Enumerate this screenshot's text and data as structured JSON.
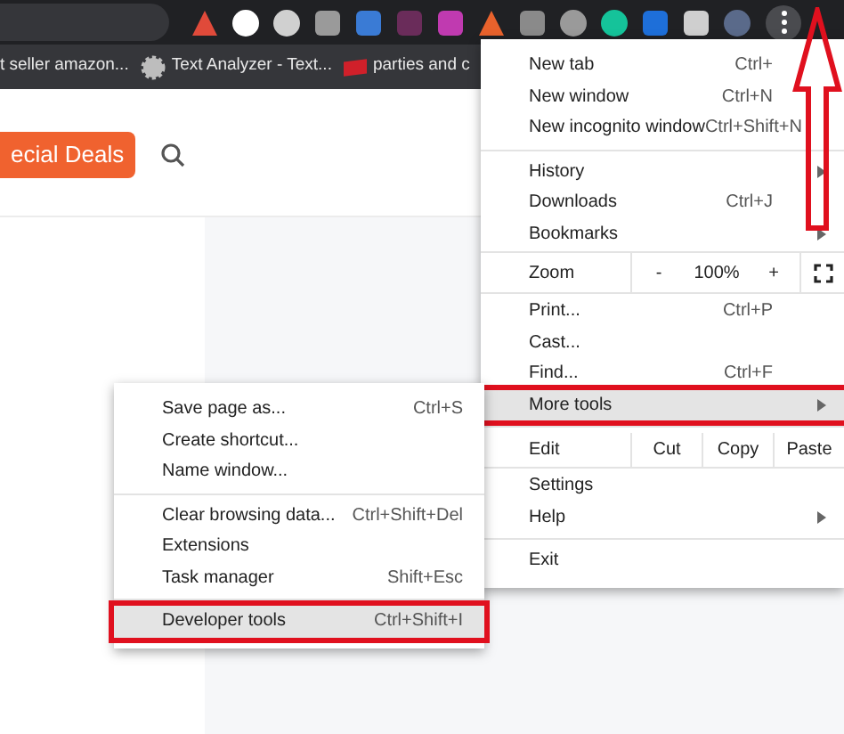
{
  "bookmarks": [
    {
      "label": "t seller amazon..."
    },
    {
      "label": "Text Analyzer - Text..."
    },
    {
      "label": "parties and c"
    }
  ],
  "page": {
    "deals_button": "ecial Deals"
  },
  "menu": {
    "items": [
      {
        "kind": "item",
        "label": "New tab",
        "shortcut": "Ctrl+",
        "submenu": false,
        "selected": false
      },
      {
        "kind": "item",
        "label": "New window",
        "shortcut": "Ctrl+N",
        "submenu": false,
        "selected": false
      },
      {
        "kind": "item",
        "label": "New incognito window",
        "shortcut": "Ctrl+Shift+N",
        "submenu": false,
        "selected": false
      },
      {
        "kind": "separator"
      },
      {
        "kind": "item",
        "label": "History",
        "submenu": true,
        "selected": false
      },
      {
        "kind": "item",
        "label": "Downloads",
        "shortcut": "Ctrl+J",
        "submenu": false,
        "selected": false
      },
      {
        "kind": "item",
        "label": "Bookmarks",
        "submenu": true,
        "selected": false
      },
      {
        "kind": "zoom",
        "label": "Zoom",
        "minus": "-",
        "value": "100%",
        "plus": "+"
      },
      {
        "kind": "item",
        "label": "Print...",
        "shortcut": "Ctrl+P",
        "submenu": false,
        "selected": false
      },
      {
        "kind": "item",
        "label": "Cast...",
        "submenu": false,
        "selected": false
      },
      {
        "kind": "item",
        "label": "Find...",
        "shortcut": "Ctrl+F",
        "submenu": false,
        "selected": false
      },
      {
        "kind": "item",
        "label": "More tools",
        "submenu": true,
        "selected": true
      },
      {
        "kind": "separator"
      },
      {
        "kind": "edit",
        "label": "Edit",
        "buttons": [
          "Cut",
          "Copy",
          "Paste"
        ]
      },
      {
        "kind": "item",
        "label": "Settings",
        "submenu": false,
        "selected": false
      },
      {
        "kind": "item",
        "label": "Help",
        "submenu": true,
        "selected": false
      },
      {
        "kind": "separator"
      },
      {
        "kind": "item",
        "label": "Exit",
        "submenu": false,
        "selected": false
      }
    ]
  },
  "submenu": {
    "items": [
      {
        "kind": "item",
        "label": "Save page as...",
        "shortcut": "Ctrl+S",
        "selected": false
      },
      {
        "kind": "item",
        "label": "Create shortcut...",
        "selected": false
      },
      {
        "kind": "item",
        "label": "Name window...",
        "selected": false
      },
      {
        "kind": "separator"
      },
      {
        "kind": "item",
        "label": "Clear browsing data...",
        "shortcut": "Ctrl+Shift+Del",
        "selected": false
      },
      {
        "kind": "item",
        "label": "Extensions",
        "selected": false
      },
      {
        "kind": "item",
        "label": "Task manager",
        "shortcut": "Shift+Esc",
        "selected": false
      },
      {
        "kind": "separator"
      },
      {
        "kind": "item",
        "label": "Developer tools",
        "shortcut": "Ctrl+Shift+I",
        "selected": true
      }
    ]
  }
}
